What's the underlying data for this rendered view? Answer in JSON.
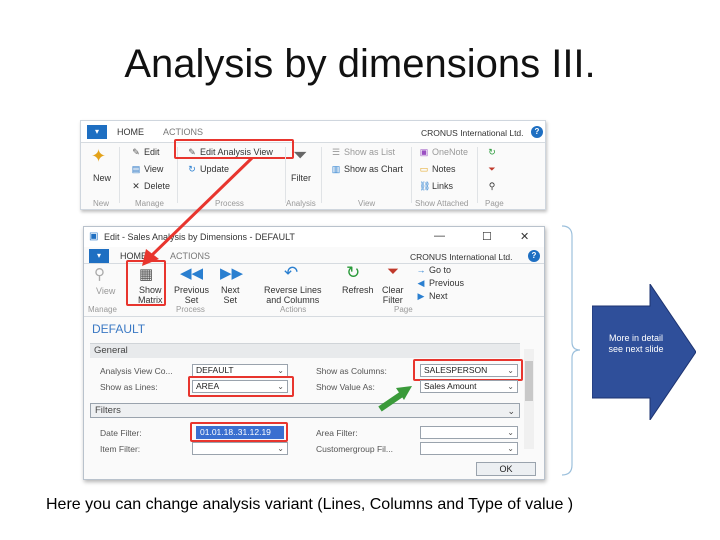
{
  "slide": {
    "title": "Analysis by dimensions III.",
    "caption": "Here you can change analysis variant (Lines, Columns and Type of value )"
  },
  "ribbon": {
    "tabs": [
      "HOME",
      "ACTIONS"
    ],
    "company": "CRONUS International Ltd.",
    "buttons": {
      "new": "New",
      "edit": "Edit",
      "view": "View",
      "delete": "Delete",
      "edit_analysis_view": "Edit Analysis View",
      "update": "Update",
      "filter": "Filter",
      "show_as_list": "Show as List",
      "show_as_chart": "Show as Chart",
      "onenote": "OneNote",
      "notes": "Notes",
      "links": "Links"
    },
    "groups": [
      "New",
      "Manage",
      "Process",
      "Analysis",
      "View",
      "Show Attached",
      "Page"
    ]
  },
  "dialog": {
    "window_title": "Edit - Sales Analysis by Dimensions - DEFAULT",
    "tabs": [
      "HOME",
      "ACTIONS"
    ],
    "company": "CRONUS International Ltd.",
    "buttons": {
      "view": "View",
      "show_matrix": [
        "Show",
        "Matrix"
      ],
      "previous_set": [
        "Previous",
        "Set"
      ],
      "next_set": [
        "Next",
        "Set"
      ],
      "reverse_lines": [
        "Reverse Lines",
        "and Columns"
      ],
      "refresh": "Refresh",
      "clear_filter": [
        "Clear",
        "Filter"
      ],
      "go_to": "Go to",
      "previous": "Previous",
      "next": "Next"
    },
    "groups": [
      "Manage",
      "Process",
      "Actions",
      "Page"
    ],
    "record_title": "DEFAULT",
    "general": {
      "header": "General",
      "analysis_view_code_label": "Analysis View Co...",
      "analysis_view_code_value": "DEFAULT",
      "show_as_lines_label": "Show as Lines:",
      "show_as_lines_value": "AREA",
      "show_as_columns_label": "Show as Columns:",
      "show_as_columns_value": "SALESPERSON",
      "show_value_as_label": "Show Value As:",
      "show_value_as_value": "Sales Amount"
    },
    "filters": {
      "header": "Filters",
      "date_filter_label": "Date Filter:",
      "date_filter_value": "01.01.18..31.12.19",
      "area_filter_label": "Area Filter:",
      "item_filter_label": "Item Filter:",
      "customergroup_filter_label": "Customergroup Fil..."
    },
    "ok": "OK"
  },
  "callout": {
    "text": "More in detail see next slide"
  },
  "colors": {
    "highlight": "#e8352e",
    "accent_blue": "#1e6fc2",
    "callout_fill": "#2f4f9a",
    "green_arrow": "#3a9a3a"
  }
}
